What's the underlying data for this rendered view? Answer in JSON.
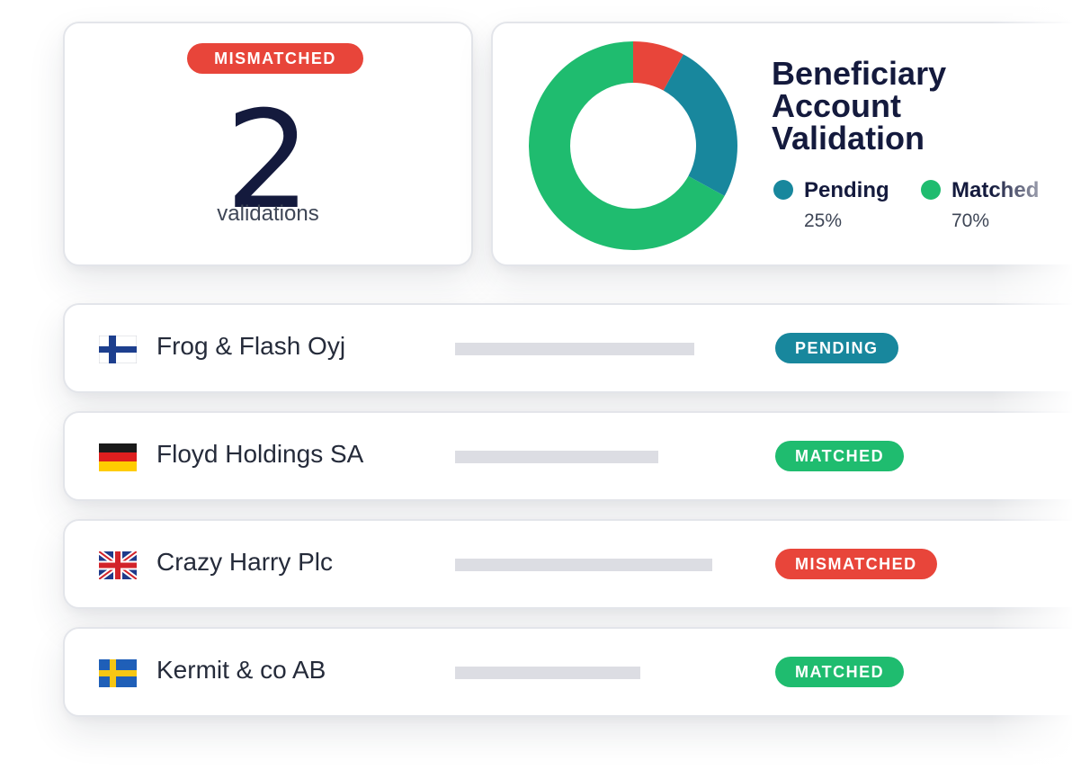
{
  "summary": {
    "badge": "MISMATCHED",
    "count": "2",
    "label": "validations"
  },
  "chart": {
    "title_lines": [
      "Beneficiary",
      "Account",
      "Validation"
    ],
    "legend": [
      {
        "name": "Pending",
        "value": "25%"
      },
      {
        "name": "Matched",
        "value": "70%"
      }
    ]
  },
  "chart_data": {
    "type": "pie",
    "categories": [
      "Mismatched",
      "Pending",
      "Matched"
    ],
    "values": [
      8,
      25,
      67
    ],
    "colors": [
      "#e8453a",
      "#18879d",
      "#1fbc6f"
    ],
    "donut": true,
    "start_angle_deg": 0
  },
  "rows": [
    {
      "flag": "finland-flag",
      "name": "Frog & Flash Oyj",
      "status": "PENDING",
      "status_color": "teal"
    },
    {
      "flag": "germany-flag",
      "name": "Floyd Holdings SA",
      "status": "MATCHED",
      "status_color": "green"
    },
    {
      "flag": "uk-flag",
      "name": "Crazy Harry Plc",
      "status": "MISMATCHED",
      "status_color": "red"
    },
    {
      "flag": "sweden-flag",
      "name": "Kermit & co AB",
      "status": "MATCHED",
      "status_color": "green"
    }
  ]
}
